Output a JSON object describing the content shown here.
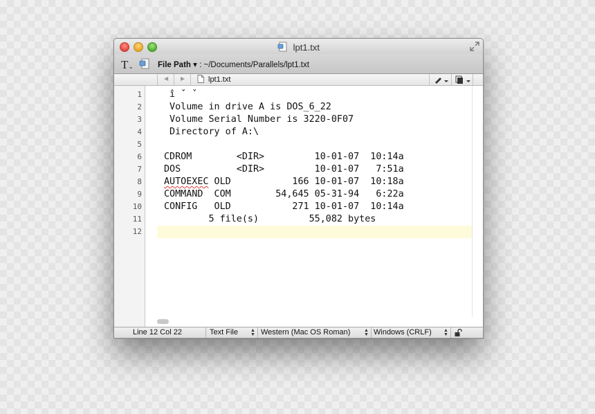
{
  "window": {
    "title": "lpt1.txt"
  },
  "toolbar": {
    "text_tool_label": "T",
    "file_path_label": "File Path",
    "file_path_value": "~/Documents/Parallels/lpt1.txt"
  },
  "navbar": {
    "back_arrow": "◀",
    "forward_arrow": "▶",
    "file_name": "lpt1.txt"
  },
  "editor": {
    "lines": [
      {
        "number": "1",
        "text": " î ˇ ˇ"
      },
      {
        "number": "2",
        "text": " Volume in drive A is DOS_6_22"
      },
      {
        "number": "3",
        "text": " Volume Serial Number is 3220-0F07"
      },
      {
        "number": "4",
        "text": " Directory of A:\\"
      },
      {
        "number": "5",
        "text": ""
      },
      {
        "number": "6",
        "text": "CDROM        <DIR>         10-01-07  10:14a"
      },
      {
        "number": "7",
        "text": "DOS          <DIR>         10-01-07   7:51a"
      },
      {
        "number": "8",
        "text_word": "AUTOEXEC",
        "text_rest": " OLD           166 10-01-07  10:18a"
      },
      {
        "number": "9",
        "text": "COMMAND  COM        54,645 05-31-94   6:22a"
      },
      {
        "number": "10",
        "text": "CONFIG   OLD           271 10-01-07  10:14a"
      },
      {
        "number": "11",
        "text": "        5 file(s)         55,082 bytes"
      },
      {
        "number": "12",
        "text": ""
      }
    ],
    "current_line": 12
  },
  "statusbar": {
    "position": "Line 12 Col 22",
    "file_type": "Text File",
    "encoding": "Western (Mac OS Roman)",
    "line_endings": "Windows (CRLF)"
  },
  "colors": {
    "current_line_highlight": "#fefbdb",
    "spell_error": "#e03a3a"
  }
}
